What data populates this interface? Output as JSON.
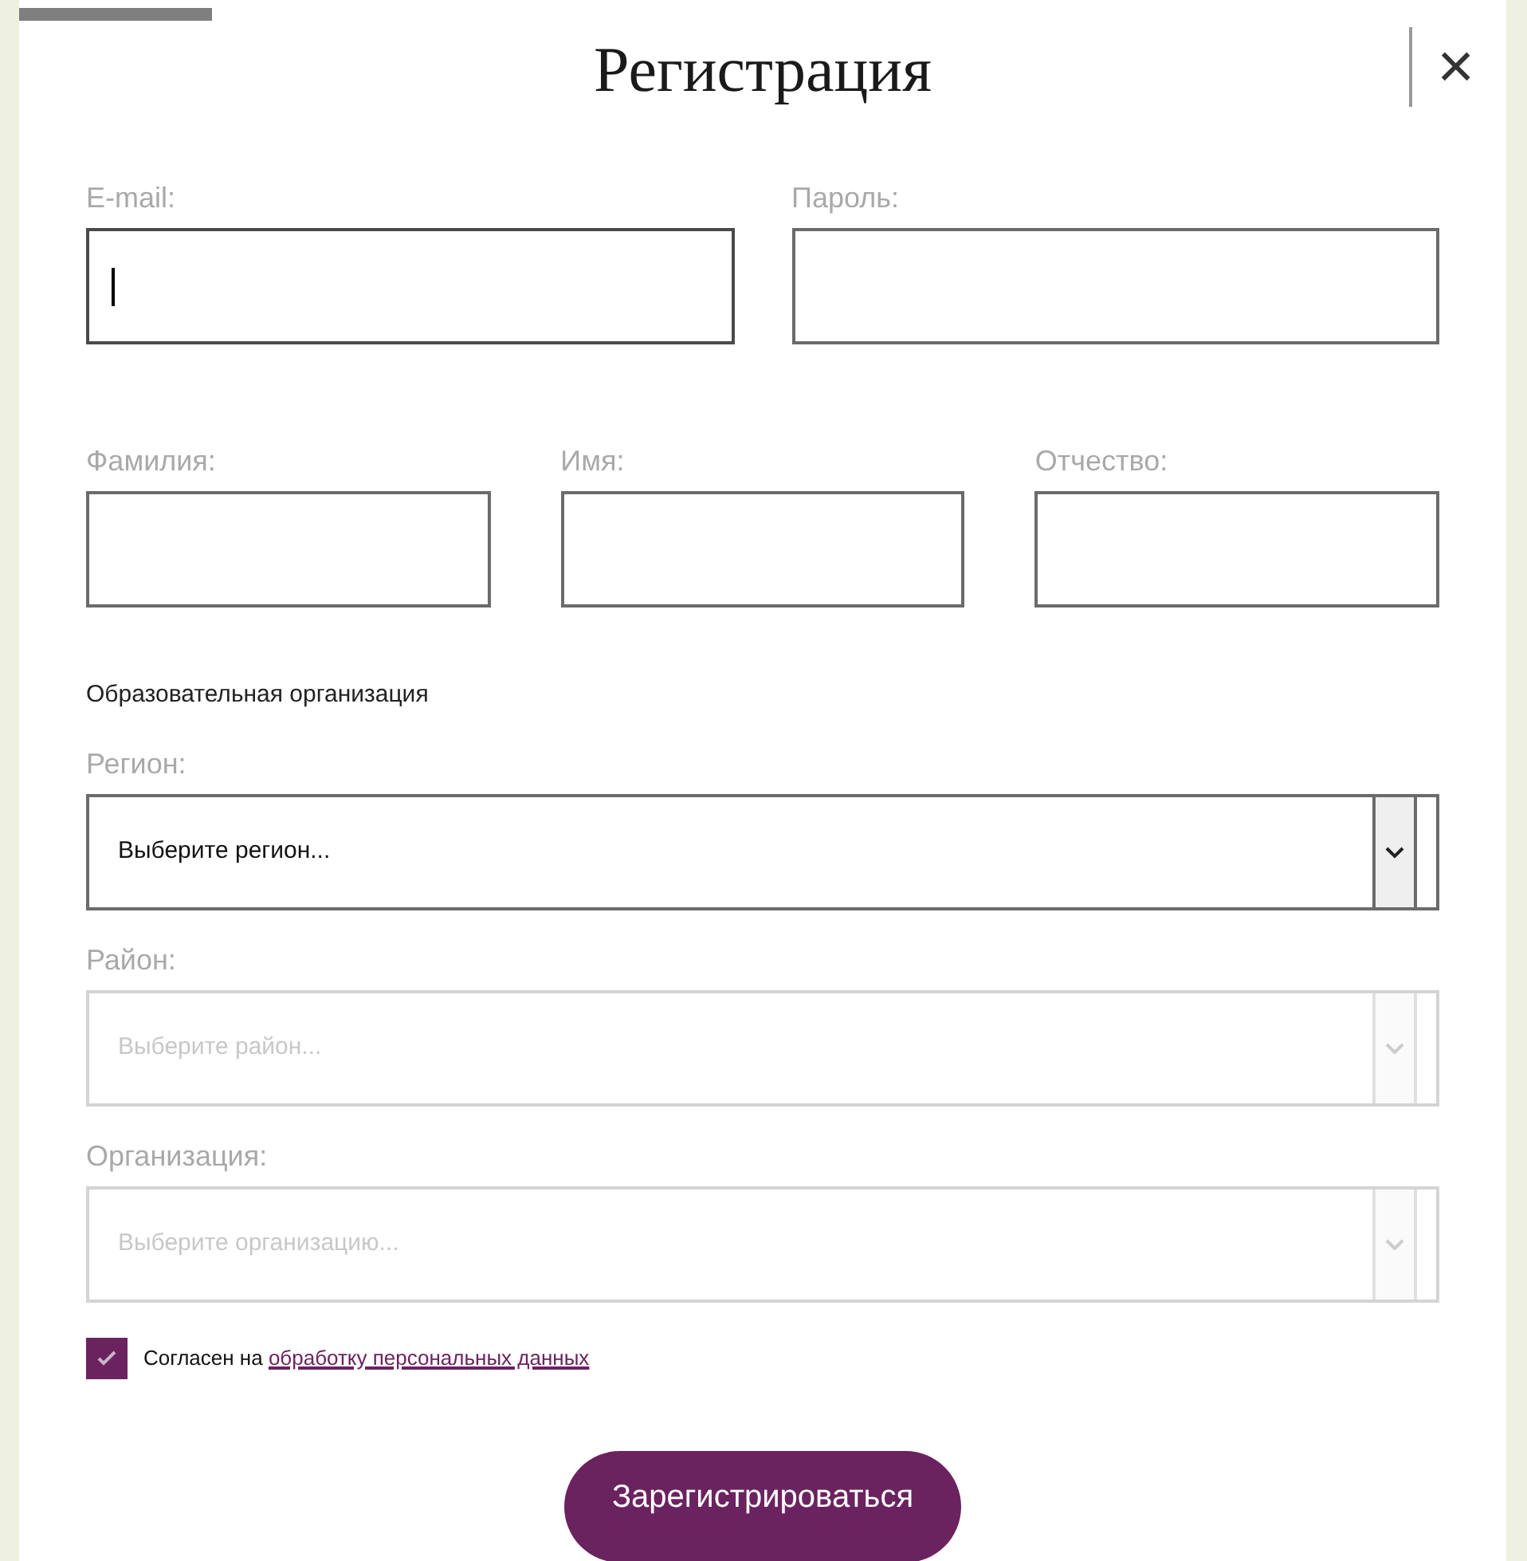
{
  "dialog": {
    "title": "Регистрация",
    "close": "×"
  },
  "account_fields": [
    {
      "label": "E-mail:",
      "focused": true
    },
    {
      "label": "Пароль:",
      "focused": false
    }
  ],
  "name_fields": [
    {
      "label": "Фамилия:"
    },
    {
      "label": "Имя:"
    },
    {
      "label": "Отчество:"
    }
  ],
  "section_title": "Образовательная организация",
  "selects": [
    {
      "label": "Регион:",
      "placeholder": "Выберите регион...",
      "disabled": false
    },
    {
      "label": "Район:",
      "placeholder": "Выберите район...",
      "disabled": true
    },
    {
      "label": "Организация:",
      "placeholder": "Выберите организацию...",
      "disabled": true
    }
  ],
  "consent": {
    "checked": true,
    "text": "Согласен на",
    "link": "обработку персональных данных"
  },
  "submit": "Зарегистрироваться"
}
